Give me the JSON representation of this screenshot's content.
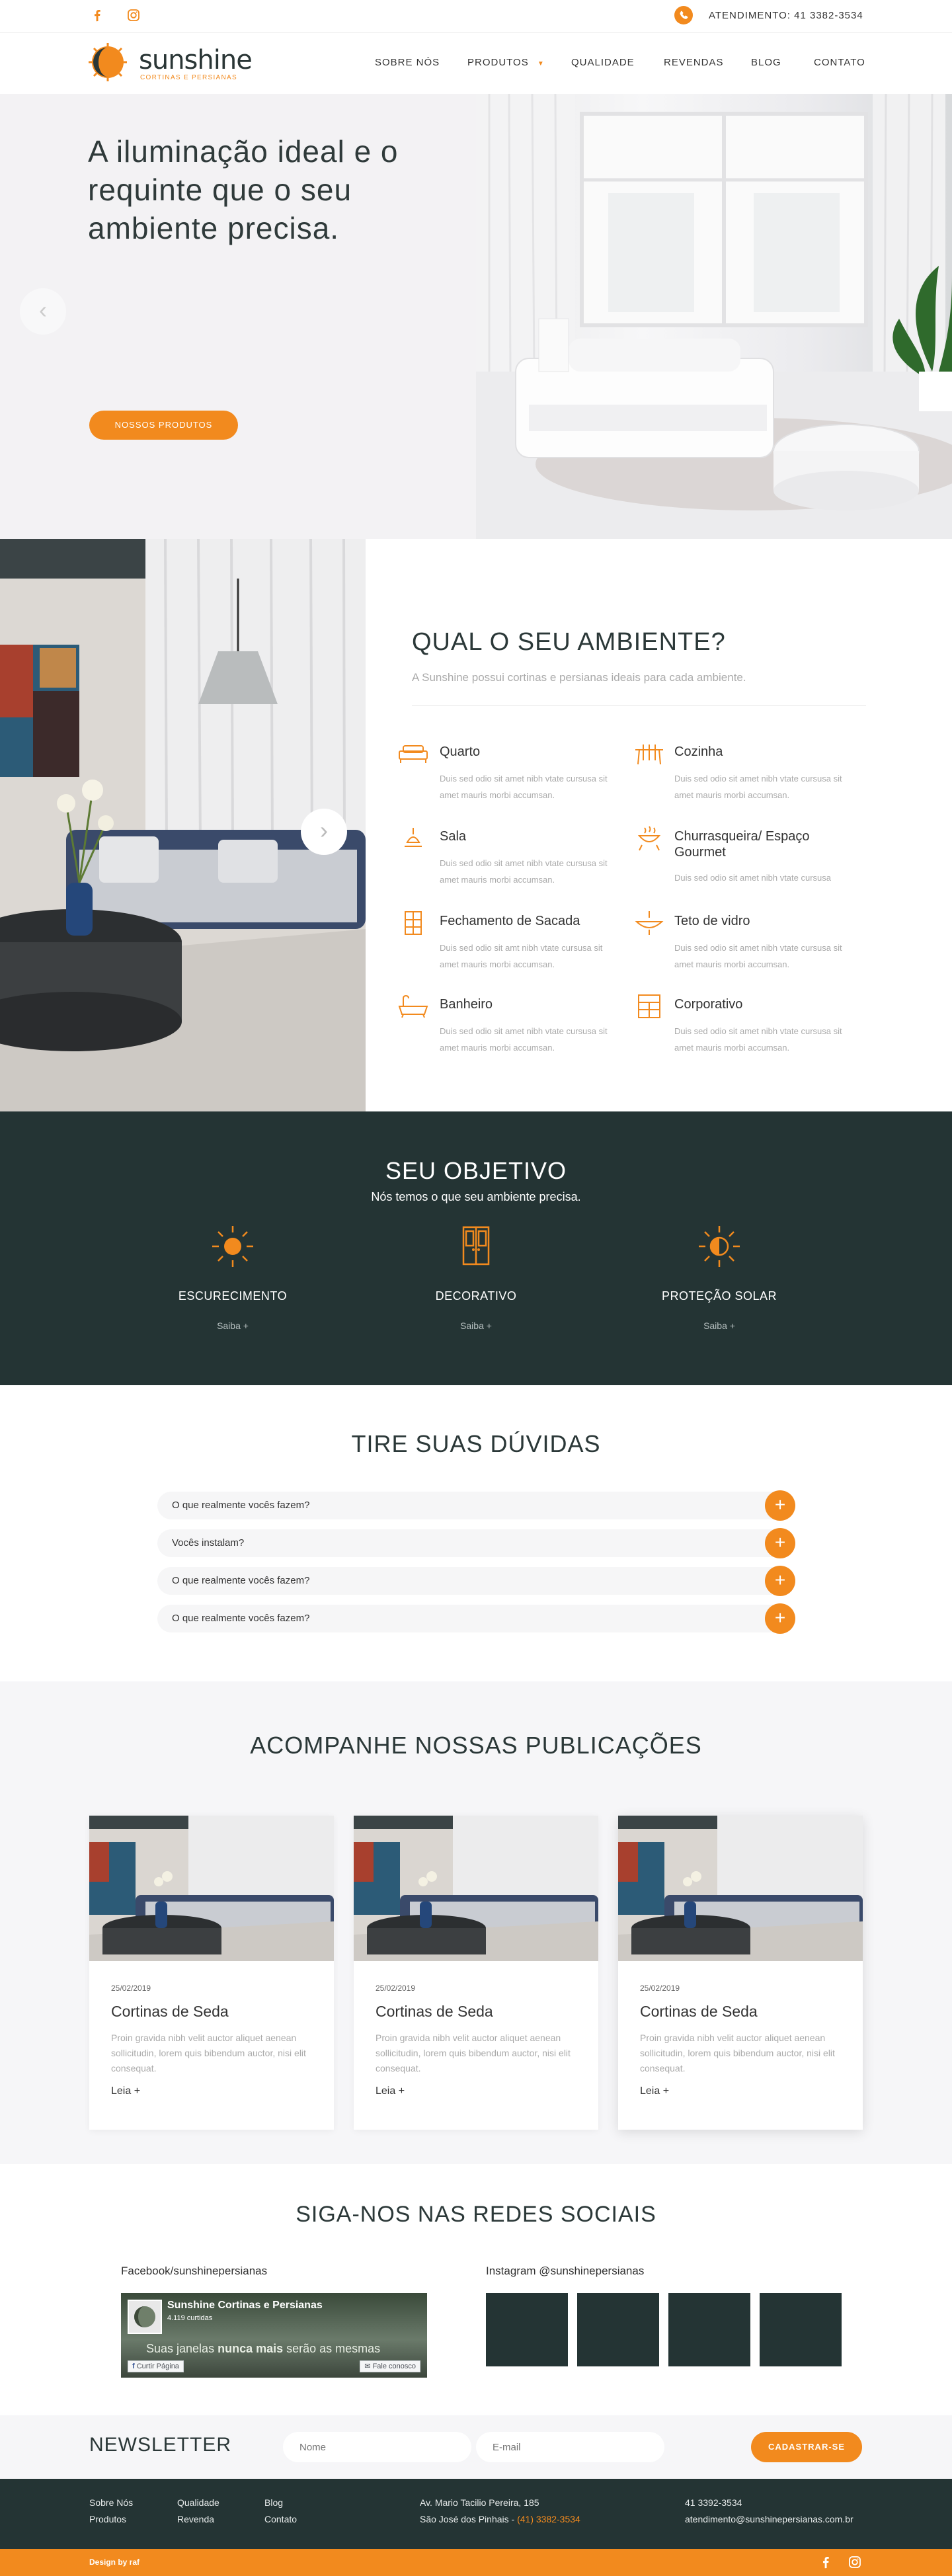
{
  "topbar": {
    "attendance": "ATENDIMENTO: 41 3382-3534",
    "icons": [
      "facebook-icon",
      "instagram-icon",
      "phone-icon"
    ]
  },
  "header": {
    "logo_name": "sunshine",
    "logo_sub": "CORTINAS E PERSIANAS",
    "nav": [
      {
        "label": "SOBRE NÓS"
      },
      {
        "label": "PRODUTOS"
      },
      {
        "label": "QUALIDADE"
      },
      {
        "label": "REVENDAS"
      },
      {
        "label": "BLOG"
      },
      {
        "label": "CONTATO"
      }
    ]
  },
  "hero": {
    "title": "A iluminação ideal e o requinte que o seu ambiente precisa.",
    "button": "NOSSOS PRODUTOS"
  },
  "ambiente": {
    "title": "QUAL O SEU AMBIENTE?",
    "subtitle": "A Sunshine possui cortinas e persianas ideais para cada ambiente.",
    "items": [
      {
        "title": "Quarto",
        "desc": "Duis sed odio sit amet nibh vtate cursusa sit amet mauris morbi accumsan.",
        "icon": "bed-icon"
      },
      {
        "title": "Cozinha",
        "desc": "Duis sed odio sit amet nibh vtate cursusa sit amet mauris morbi accumsan.",
        "icon": "kitchen-icon"
      },
      {
        "title": "Sala",
        "desc": "Duis sed odio sit amet nibh vtate cursusa sit amet mauris morbi accumsan.",
        "icon": "lamp-icon"
      },
      {
        "title": "Churrasqueira/ Espaço Gourmet",
        "desc": "Duis sed odio sit amet nibh vtate cursusa",
        "icon": "grill-icon"
      },
      {
        "title": "Fechamento de Sacada",
        "desc": "Duis sed odio sit amt nibh vtate cursusa sit amet mauris morbi accumsan.",
        "icon": "window-icon"
      },
      {
        "title": "Teto de vidro",
        "desc": "Duis sed odio sit amet nibh vtate cursusa sit amet mauris morbi accumsan.",
        "icon": "ceiling-lamp-icon"
      },
      {
        "title": "Banheiro",
        "desc": "Duis sed odio sit amet nibh vtate cursusa sit amet mauris morbi accumsan.",
        "icon": "bathtub-icon"
      },
      {
        "title": "Corporativo",
        "desc": "Duis sed odio sit amet nibh vtate cursusa sit amet mauris morbi accumsan.",
        "icon": "office-icon"
      }
    ]
  },
  "objetivo": {
    "title": "SEU OBJETIVO",
    "subtitle": "Nós temos o que seu ambiente precisa.",
    "items": [
      {
        "title": "ESCURECIMENTO",
        "link": "Saiba +",
        "icon": "sun-icon"
      },
      {
        "title": "DECORATIVO",
        "link": "Saiba +",
        "icon": "door-icon"
      },
      {
        "title": "PROTEÇÃO SOLAR",
        "link": "Saiba +",
        "icon": "half-sun-icon"
      }
    ]
  },
  "faq": {
    "title": "TIRE SUAS DÚVIDAS",
    "items": [
      {
        "q": "O que realmente vocês fazem?"
      },
      {
        "q": "Vocês instalam?"
      },
      {
        "q": "O que realmente vocês fazem?"
      },
      {
        "q": "O que realmente vocês fazem?"
      }
    ]
  },
  "publicacoes": {
    "title": "ACOMPANHE NOSSAS PUBLICAÇÕES",
    "cards": [
      {
        "date": "25/02/2019",
        "title": "Cortinas de Seda",
        "text": "Proin gravida nibh velit auctor aliquet aenean sollicitudin, lorem quis bibendum auctor, nisi elit consequat.",
        "link": "Leia +"
      },
      {
        "date": "25/02/2019",
        "title": "Cortinas de Seda",
        "text": "Proin gravida nibh velit auctor aliquet aenean sollicitudin, lorem quis bibendum auctor, nisi elit consequat.",
        "link": "Leia +"
      },
      {
        "date": "25/02/2019",
        "title": "Cortinas de Seda",
        "text": "Proin gravida nibh velit auctor aliquet aenean sollicitudin, lorem quis bibendum auctor, nisi elit consequat.",
        "link": "Leia +"
      }
    ]
  },
  "social": {
    "title": "SIGA-NOS NAS REDES SOCIAIS",
    "facebook_label": "Facebook/sunshinepersianas",
    "instagram_label": "Instagram @sunshinepersianas",
    "fb": {
      "page_name": "Sunshine Cortinas e Persianas",
      "likes": "4.119 curtidas",
      "tagline_start": "Suas janelas ",
      "tagline_bold": "nunca mais",
      "tagline_end": " serão as mesmas",
      "like_btn": "Curtir Página",
      "contact_btn": "Fale conosco"
    }
  },
  "newsletter": {
    "title": "NEWSLETTER",
    "name_placeholder": "Nome",
    "email_placeholder": "E-mail",
    "button": "CADASTRAR-SE"
  },
  "footer": {
    "col1": [
      "Sobre Nós",
      "Produtos"
    ],
    "col2": [
      "Qualidade",
      "Revenda"
    ],
    "col3": [
      "Blog",
      "Contato"
    ],
    "address1": "Av. Mario Tacilio Pereira, 185",
    "address2_a": "São José dos Pinhais - ",
    "address2_b": "(41) 3382-3534",
    "phone": "41 3392-3534",
    "email": "atendimento@sunshinepersianas.com.br",
    "credit": "Design by raf"
  },
  "colors": {
    "accent": "#f28a1e",
    "dark": "#243434"
  }
}
